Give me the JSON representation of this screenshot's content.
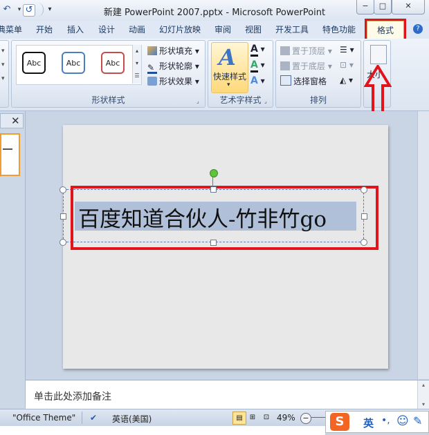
{
  "window": {
    "title": "新建 PowerPoint 2007.pptx - Microsoft PowerPoint",
    "minimize": "−",
    "maximize": "□",
    "close": "✕"
  },
  "quick_access": {
    "undo": "↶",
    "redo": "↺",
    "customize": "▾"
  },
  "tabs": [
    {
      "label": "典菜单"
    },
    {
      "label": "开始"
    },
    {
      "label": "插入"
    },
    {
      "label": "设计"
    },
    {
      "label": "动画"
    },
    {
      "label": "幻灯片放映"
    },
    {
      "label": "审阅"
    },
    {
      "label": "视图"
    },
    {
      "label": "开发工具"
    },
    {
      "label": "特色功能"
    },
    {
      "label": "格式",
      "active": true
    }
  ],
  "ribbon": {
    "shape_styles": {
      "label": "形状样式",
      "samples": [
        "Abc",
        "Abc",
        "Abc"
      ],
      "fill": "形状填充",
      "outline": "形状轮廓",
      "effects": "形状效果"
    },
    "wordart": {
      "label": "艺术字样式",
      "quick_styles": "快速样式",
      "text_fill_glyph": "A",
      "text_outline_glyph": "A",
      "text_effects_glyph": "A"
    },
    "arrange": {
      "label": "排列",
      "bring_front": "置于顶层",
      "send_back": "置于底层",
      "selection_pane": "选择窗格"
    },
    "size": {
      "partial_label": "大小"
    }
  },
  "slide": {
    "text": "百度知道合伙人-竹非竹go"
  },
  "notes": {
    "placeholder": "单击此处添加备注"
  },
  "status": {
    "theme": "\"Office Theme\"",
    "language": "英语(美国)",
    "zoom": "49%"
  },
  "ime": {
    "logo": "S",
    "mode": "英",
    "punct": "•,",
    "emoji": "☺",
    "tool": "✎"
  },
  "colors": {
    "annotation_red": "#e1141b",
    "active_tab_bg": "#fffbe9",
    "selection_highlight": "#b0c0d8"
  }
}
